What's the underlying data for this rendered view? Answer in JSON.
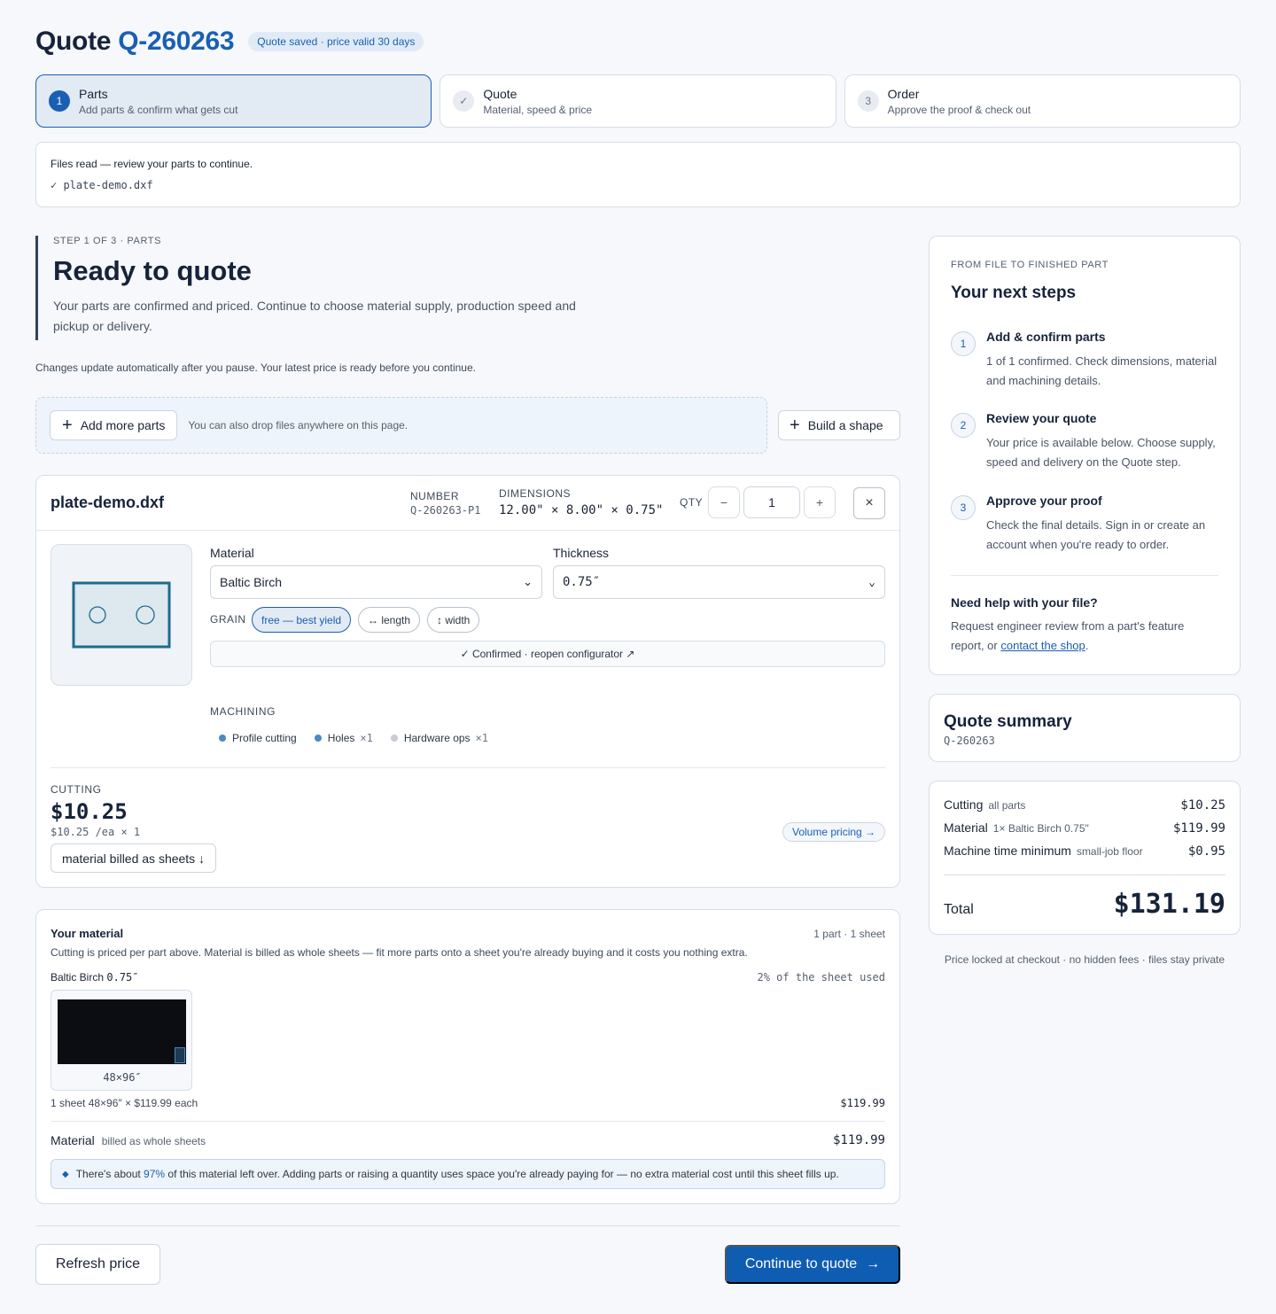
{
  "header": {
    "title_prefix": "Quote",
    "quote_id": "Q-260263",
    "saved_badge": "Quote saved · price valid 30 days"
  },
  "stepper": [
    {
      "num": "1",
      "title": "Parts",
      "subtitle": "Add parts & confirm what gets cut",
      "state": "active"
    },
    {
      "num": "✓",
      "title": "Quote",
      "subtitle": "Material, speed & price",
      "state": "done"
    },
    {
      "num": "3",
      "title": "Order",
      "subtitle": "Approve the proof & check out",
      "state": "pending"
    }
  ],
  "files": {
    "message": "Files read — review your parts to continue.",
    "file_line": "✓ plate-demo.dxf"
  },
  "hero": {
    "eyebrow": "STEP 1 OF 3 · PARTS",
    "title": "Ready to quote",
    "body": "Your parts are confirmed and priced. Continue to choose material supply, production speed and pickup or delivery."
  },
  "auto_note": "Changes update automatically after you pause. Your latest price is ready before you continue.",
  "dropzone": {
    "add_label": "Add more parts",
    "hint": "You can also drop files anywhere on this page.",
    "build_label": "Build a shape"
  },
  "part": {
    "name": "plate-demo.dxf",
    "number_label": "NUMBER",
    "number_value": "Q-260263-P1",
    "dims_label": "DIMENSIONS",
    "dims_value": "12.00\" × 8.00\" × 0.75\"",
    "qty_label": "QTY",
    "qty_minus": "−",
    "qty_value": "1",
    "qty_plus": "+",
    "close_icon": "×",
    "material_label": "Material",
    "material_value": "Baltic Birch",
    "thickness_label": "Thickness",
    "thickness_value": "0.75″",
    "grain_label": "GRAIN",
    "grain_options": [
      "free — best yield",
      "↔ length",
      "↕ width"
    ],
    "grain_selected": "free — best yield",
    "confirmed_text": "✓ Confirmed · reopen configurator ↗",
    "machining_label": "MACHINING",
    "machining": [
      {
        "label": "Profile cutting",
        "count": "",
        "color": "#4a88c8"
      },
      {
        "label": "Holes",
        "count": "×1",
        "color": "#4a88c8"
      },
      {
        "label": "Hardware ops",
        "count": "×1",
        "color": "#c8ccd3"
      }
    ],
    "cutting_label": "CUTTING",
    "cutting_price": "$10.25",
    "cutting_each": "$10.25 /ea × 1",
    "billed_label": "material billed as sheets ↓",
    "volume_label": "Volume pricing →"
  },
  "material": {
    "title": "Your material",
    "count": "1 part · 1 sheet",
    "description": "Cutting is priced per part above. Material is billed as whole sheets — fit more parts onto a sheet you're already buying and it costs you nothing extra.",
    "name": "Baltic Birch",
    "thickness": "0.75″",
    "used": "2% of the sheet used",
    "sheet_size": "48×96″",
    "sheet_line": "1 sheet 48×96″ × $119.99 each",
    "sheet_price": "$119.99",
    "total_label": "Material",
    "total_sub": "billed as whole sheets",
    "total_value": "$119.99",
    "leftover_pre": "There's about ",
    "leftover_pct": "97%",
    "leftover_post": " of this material left over. Adding parts or raising a quantity uses space you're already paying for — no extra material cost until this sheet fills up."
  },
  "actions": {
    "refresh": "Refresh price",
    "continue": "Continue to quote",
    "continue_arrow": "→"
  },
  "next_steps": {
    "eyebrow": "FROM FILE TO FINISHED PART",
    "title": "Your next steps",
    "steps": [
      {
        "num": "1",
        "title": "Add & confirm parts",
        "desc": "1 of 1 confirmed. Check dimensions, material and machining details."
      },
      {
        "num": "2",
        "title": "Review your quote",
        "desc": "Your price is available below. Choose supply, speed and delivery on the Quote step."
      },
      {
        "num": "3",
        "title": "Approve your proof",
        "desc": "Check the final details. Sign in or create an account when you're ready to order."
      }
    ],
    "help_title": "Need help with your file?",
    "help_pre": "Request engineer review from a part's feature report, or ",
    "help_link": "contact the shop",
    "help_post": "."
  },
  "summary": {
    "title": "Quote summary",
    "quote_id": "Q-260263",
    "rows": [
      {
        "label": "Cutting",
        "sub": "all parts",
        "value": "$10.25"
      },
      {
        "label": "Material",
        "sub": "1× Baltic Birch 0.75\"",
        "value": "$119.99"
      },
      {
        "label": "Machine time minimum",
        "sub": "small-job floor",
        "value": "$0.95"
      }
    ],
    "total_label": "Total",
    "total_value": "$131.19",
    "footnote": "Price locked at checkout · no hidden fees · files stay private"
  },
  "colors": {
    "accent": "#1a5fb4",
    "primary_button": "#0f5cb3",
    "ink": "#16233a",
    "part_outline": "#1e6b8c"
  }
}
